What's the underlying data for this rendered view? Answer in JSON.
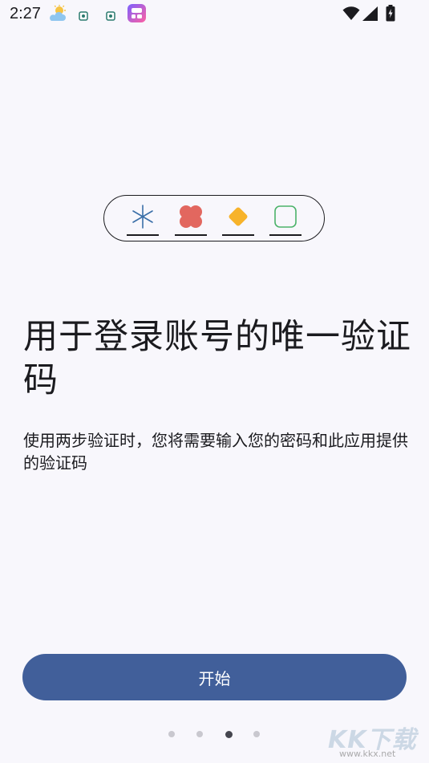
{
  "status_bar": {
    "time": "2:27",
    "icons": [
      "weather-sun-cloud-icon",
      "notification-app-icon",
      "notification-app-icon",
      "widget-app-icon",
      "wifi-icon",
      "signal-icon",
      "battery-charging-icon"
    ]
  },
  "illustration": {
    "slots": [
      "asterisk-icon",
      "flower-shape-icon",
      "diamond-icon",
      "rounded-square-icon"
    ],
    "colors": {
      "asterisk": "#3a6fa8",
      "flower": "#e2675f",
      "diamond": "#f7b32b",
      "square": "#4cb36a"
    }
  },
  "headline": "用于登录账号的唯一验证码",
  "body": "使用两步验证时，您将需要输入您的密码和此应用提供的验证码",
  "start_button": {
    "label": "开始"
  },
  "pager": {
    "count": 4,
    "active_index": 2
  },
  "watermark": {
    "text": "KK下载",
    "url": "www.kkx.net"
  },
  "colors": {
    "primary": "#415f9a",
    "background": "#f8f7fc"
  }
}
